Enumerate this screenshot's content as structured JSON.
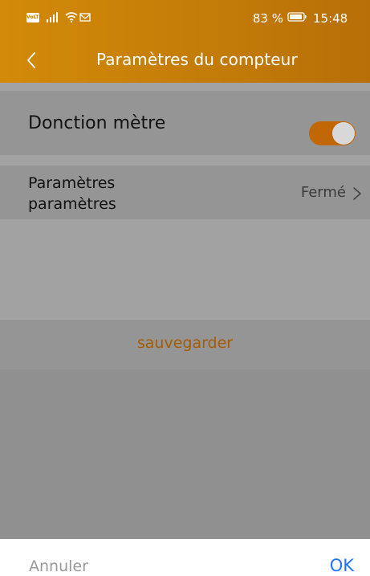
{
  "status_bar": {
    "network_badge": "VoLTE",
    "battery_text": "83 %",
    "time": "15:48",
    "icons": [
      "volte-icon",
      "signal-icon",
      "wifi-icon",
      "mail-icon",
      "battery-icon"
    ]
  },
  "header": {
    "title": "Paramètres du compteur",
    "back_icon": "back-icon"
  },
  "settings": {
    "function_meter": {
      "label": "Donction mètre",
      "enabled": true
    },
    "parameters": {
      "label_line1": "Paramètres",
      "label_line2": "paramètres",
      "value": "Fermé",
      "icon": "chevron-right-icon"
    }
  },
  "actions": {
    "save_label": "sauvegarder",
    "cancel_label": "Annuler",
    "ok_label": "OK"
  },
  "colors": {
    "header": "#c47c09",
    "toggle_on": "#c16706",
    "save_text": "#a45c05",
    "ok_text": "#1f75ff"
  }
}
